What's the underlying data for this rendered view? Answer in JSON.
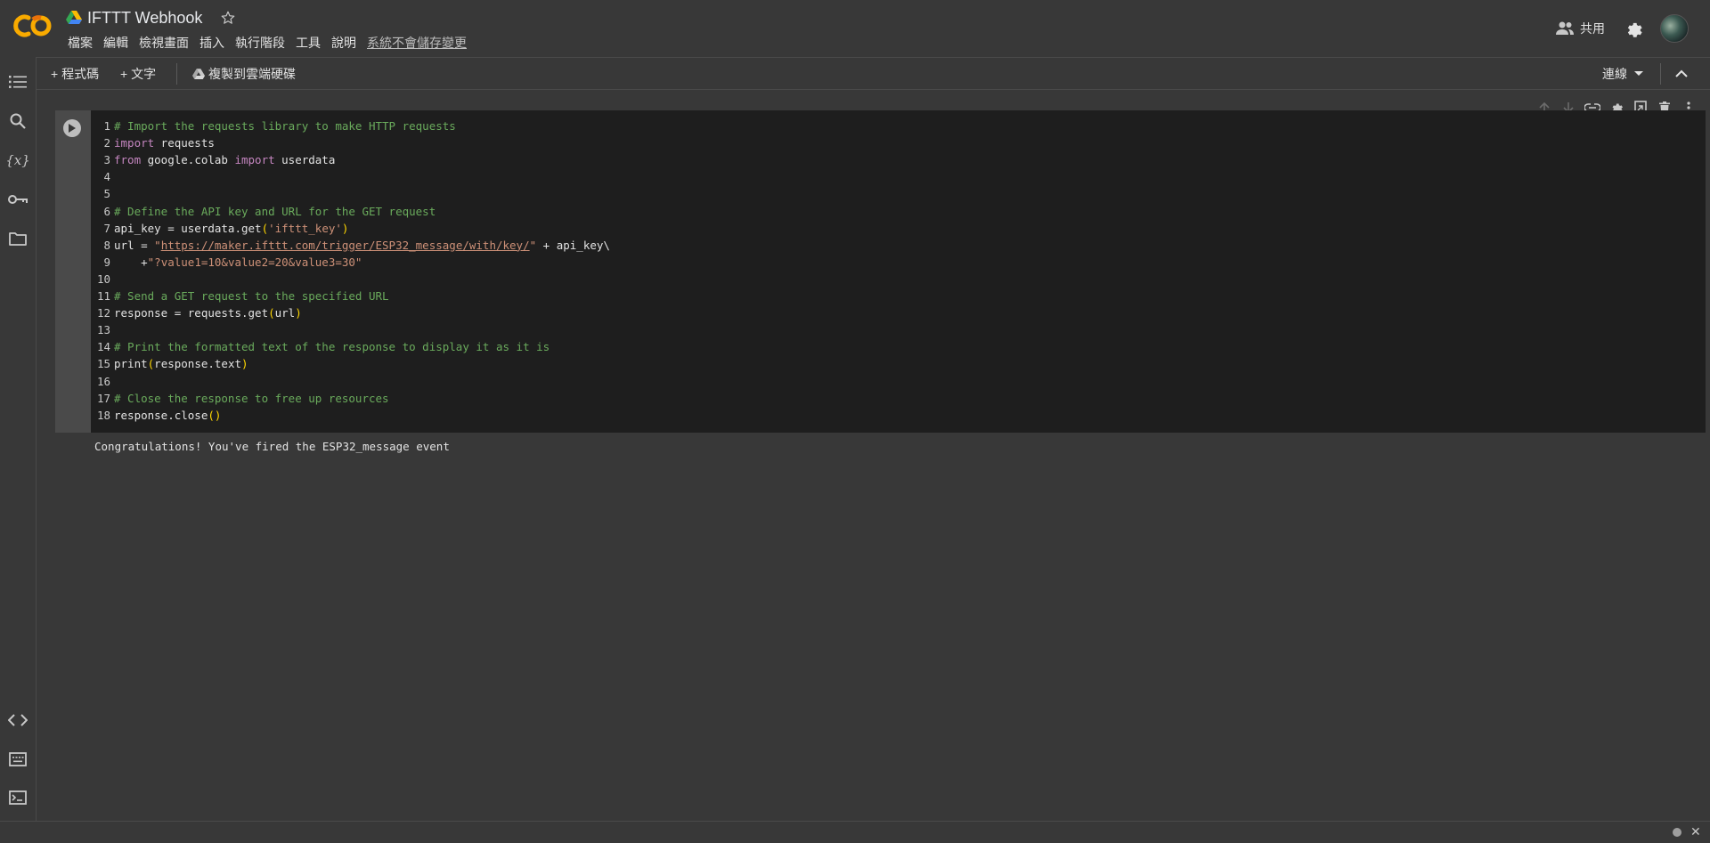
{
  "header": {
    "doc_title": "IFTTT Webhook",
    "menu": [
      "檔案",
      "編輯",
      "檢視畫面",
      "插入",
      "執行階段",
      "工具",
      "說明"
    ],
    "unsaved_notice": "系統不會儲存變更",
    "share_label": "共用"
  },
  "toolbar": {
    "add_code": "+ 程式碼",
    "add_text": "+ 文字",
    "copy_to_drive": "複製到雲端硬碟",
    "connect": "連線"
  },
  "sidebar": {
    "icons": [
      "toc-icon",
      "search-icon",
      "variables-icon",
      "secrets-key-icon",
      "folder-icon",
      "code-snippets-icon",
      "command-palette-icon",
      "terminal-icon"
    ]
  },
  "cell": {
    "lines": [
      {
        "n": "1",
        "html": "<span class=\"cmt\"># Import the requests library to make HTTP requests</span>"
      },
      {
        "n": "2",
        "html": "<span class=\"kw\">import</span> requests"
      },
      {
        "n": "3",
        "html": "<span class=\"kw\">from</span> google.colab <span class=\"kw\">import</span> userdata"
      },
      {
        "n": "4",
        "html": ""
      },
      {
        "n": "5",
        "html": ""
      },
      {
        "n": "6",
        "html": "<span class=\"cmt\"># Define the API key and URL for the GET request</span>"
      },
      {
        "n": "7",
        "html": "api_key = userdata.get<span class=\"par\">(</span><span class=\"str\">'ifttt_key'</span><span class=\"par\">)</span>"
      },
      {
        "n": "8",
        "html": "url = <span class=\"str\">\"</span><span class=\"url\">https://maker.ifttt.com/trigger/ESP32_message/with/key/</span><span class=\"str\">\"</span> + api_key\\"
      },
      {
        "n": "9",
        "html": "    +<span class=\"str\">\"?value1=10&amp;value2=20&amp;value3=30\"</span>"
      },
      {
        "n": "10",
        "html": ""
      },
      {
        "n": "11",
        "html": "<span class=\"cmt\"># Send a GET request to the specified URL</span>"
      },
      {
        "n": "12",
        "html": "response = requests.get<span class=\"par\">(</span>url<span class=\"par\">)</span>"
      },
      {
        "n": "13",
        "html": ""
      },
      {
        "n": "14",
        "html": "<span class=\"cmt\"># Print the formatted text of the response to display it as it is</span>"
      },
      {
        "n": "15",
        "html": "print<span class=\"par\">(</span>response.text<span class=\"par\">)</span>"
      },
      {
        "n": "16",
        "html": ""
      },
      {
        "n": "17",
        "html": "<span class=\"cmt\"># Close the response to free up resources</span>"
      },
      {
        "n": "18",
        "html": "response.close<span class=\"par\">()</span>"
      }
    ],
    "output": "Congratulations! You've fired the ESP32_message event"
  },
  "colors": {
    "background": "#383838",
    "code_bg": "#1e1e1e",
    "comment": "#6aab5c",
    "keyword": "#c586c0",
    "string": "#ce9178",
    "logo_orange": "#f9ab00",
    "logo_dark_orange": "#e8710a"
  }
}
